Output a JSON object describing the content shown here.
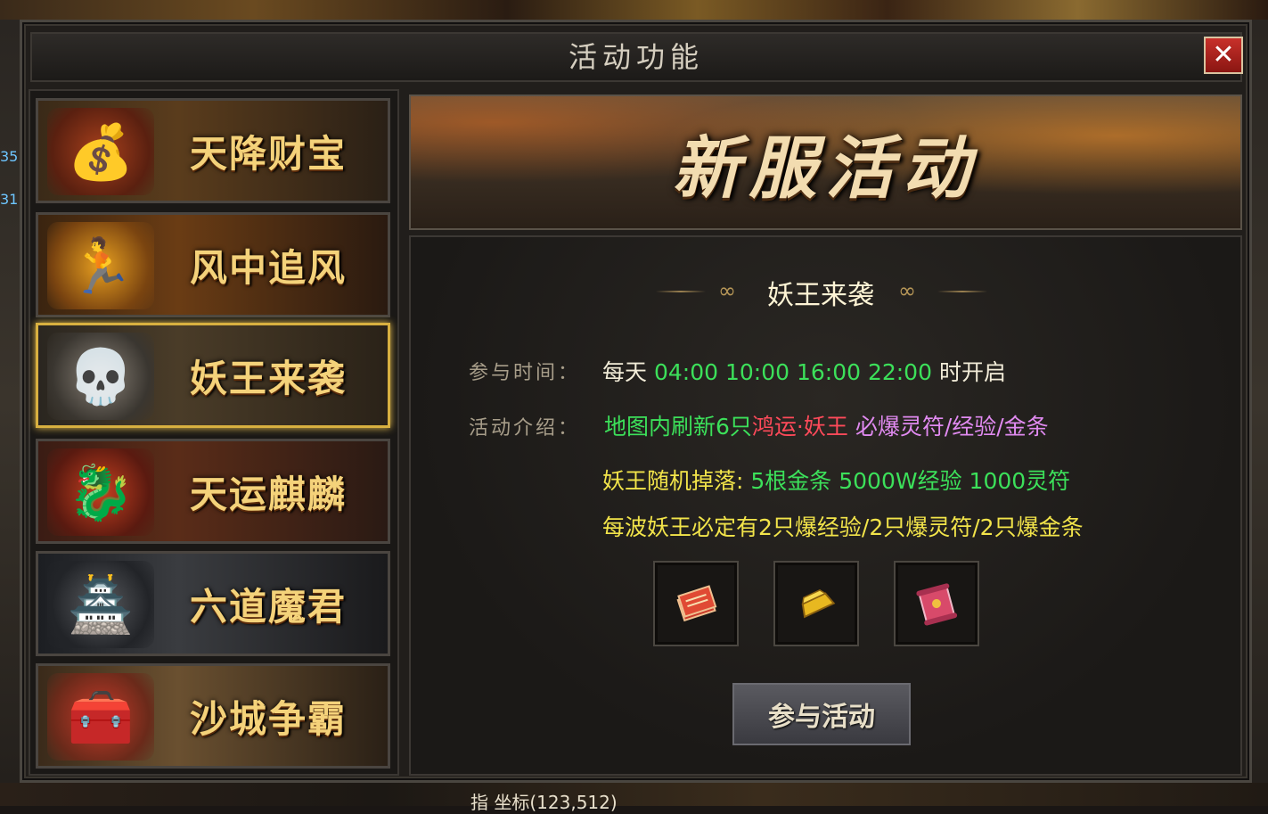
{
  "window": {
    "title": "活动功能",
    "close_icon": "✕"
  },
  "background": {
    "left_numbers": [
      "35",
      "31"
    ],
    "coordinate_text": "指   坐标(123,512)"
  },
  "menu": {
    "items": [
      {
        "label": "天降财宝",
        "icon": "treasure-pot-icon",
        "glyph": "💰",
        "active": false
      },
      {
        "label": "风中追风",
        "icon": "running-figure-icon",
        "glyph": "🏃",
        "active": false
      },
      {
        "label": "妖王来袭",
        "icon": "skeleton-demon-icon",
        "glyph": "💀",
        "active": true
      },
      {
        "label": "天运麒麟",
        "icon": "qilin-beast-icon",
        "glyph": "🐉",
        "active": false
      },
      {
        "label": "六道魔君",
        "icon": "dark-pagoda-icon",
        "glyph": "🏯",
        "active": false
      },
      {
        "label": "沙城争霸",
        "icon": "treasure-chest-icon",
        "glyph": "🧰",
        "active": false
      }
    ]
  },
  "banner": {
    "title": "新服活动"
  },
  "detail": {
    "section_title": "妖王来袭",
    "time_label": "参与时间：",
    "time_prefix": "每天",
    "time_values": "04:00 10:00 16:00 22:00",
    "time_suffix": "时开启",
    "intro_label": "活动介绍：",
    "intro_part1": "地图内刷新6只",
    "intro_part2": "鸿运·妖王",
    "intro_part3": "必爆灵符/经验/金条",
    "drop_label": "妖王随机掉落:",
    "drop_values": "5根金条 5000W经验 1000灵符",
    "wave_text": "每波妖王必定有2只爆经验/2只爆灵符/2只爆金条"
  },
  "rewards": [
    {
      "icon": "talisman-stack-icon"
    },
    {
      "icon": "gold-bar-icon"
    },
    {
      "icon": "scroll-icon"
    }
  ],
  "join_button": {
    "label": "参与活动"
  },
  "colors": {
    "green": "#3ce05a",
    "yellow": "#f2e44a",
    "red": "#ff4a5a",
    "purple": "#e08af0",
    "menu_label": "#f4d27a",
    "active_border": "#d8b040"
  }
}
